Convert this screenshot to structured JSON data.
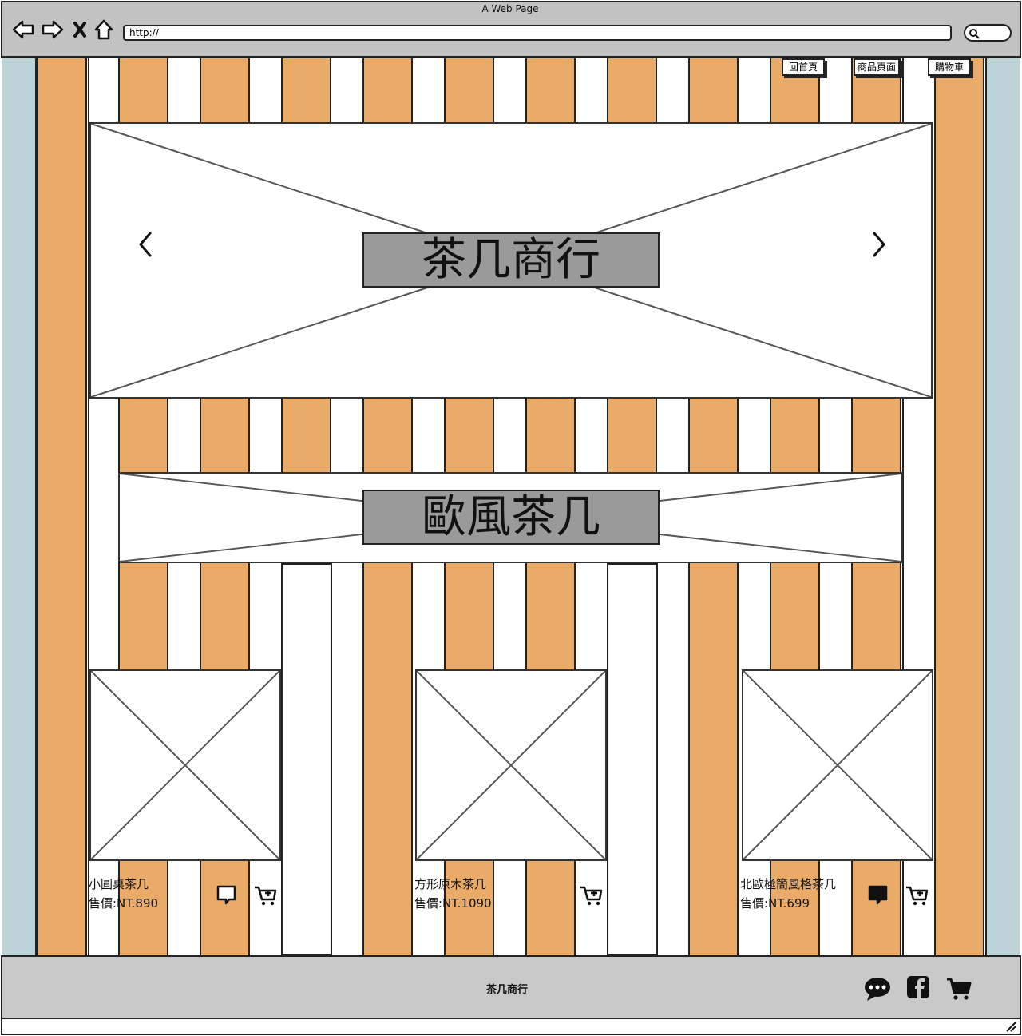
{
  "browser": {
    "window_title": "A Web Page",
    "url": "http://"
  },
  "nav": {
    "home": "回首頁",
    "products": "商品頁面",
    "cart": "購物車"
  },
  "hero": {
    "title": "茶几商行"
  },
  "category": {
    "title": "歐風茶几"
  },
  "products": [
    {
      "name": "小圓桌茶几",
      "price": "售價:NT.890",
      "icons": [
        "comment-outline-icon",
        "add-to-cart-icon"
      ]
    },
    {
      "name": "方形原木茶几",
      "price": "售價:NT.1090",
      "icons": [
        "add-to-cart-icon"
      ]
    },
    {
      "name": "北歐極簡風格茶几",
      "price": "售價:NT.699",
      "icons": [
        "comment-filled-icon",
        "add-to-cart-icon"
      ]
    }
  ],
  "footer": {
    "title": "茶几商行",
    "icons": [
      "chat-icon",
      "facebook-icon",
      "cart-icon"
    ]
  },
  "colors": {
    "stripe": "#eaaa68",
    "side": "#bcd4d8",
    "chrome": "#c2c2c2",
    "title_box": "#9a9a9a"
  }
}
